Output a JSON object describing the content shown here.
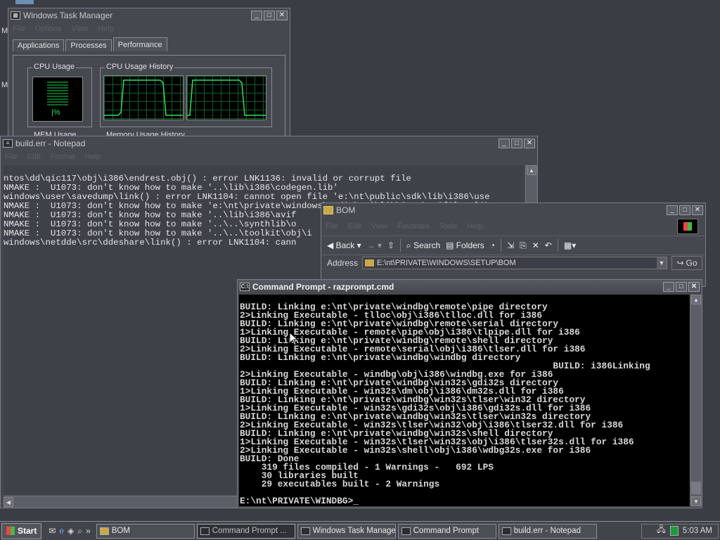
{
  "desktop": {
    "left_letter_1": "M",
    "left_letter_2": "M"
  },
  "taskmgr": {
    "title": "Windows Task Manager",
    "menu": [
      "File",
      "Options",
      "View",
      "Help"
    ],
    "tabs": [
      "Applications",
      "Processes",
      "Performance"
    ],
    "groups": {
      "cpu_usage": "CPU Usage",
      "cpu_history": "CPU Usage History",
      "mem_usage": "MEM Usage",
      "mem_history": "Memory Usage History"
    },
    "cpu_percent_label": "|%",
    "cpu_level": 0.0
  },
  "notepad": {
    "title": "build.err - Notepad",
    "menu": [
      "File",
      "Edit",
      "Format",
      "Help"
    ],
    "lines": [
      "ntos\\dd\\qic117\\obj\\i386\\endrest.obj() : error LNK1136: invalid or corrupt file",
      "NMAKE :  U1073: don't know how to make '..\\lib\\i386\\codegen.lib'",
      "windows\\user\\savedump\\link() : error LNK1104: cannot open file 'e:\\nt\\public\\sdk\\lib\\i386\\use",
      "NMAKE :  U1073: don't know how to make 'e:\\nt\\private\\windows\\media\\avi\\lib\\i386\\avifil32.lib",
      "NMAKE :  U1073: don't know how to make '..\\lib\\i386\\avif",
      "NMAKE :  U1073: don't know how to make '..\\..\\synthlib\\o",
      "NMAKE :  U1073: don't know how to make '..\\..\\toolkit\\obj\\i",
      "windows\\netdde\\src\\ddeshare\\link() : error LNK1104: cann"
    ]
  },
  "explorer": {
    "title": "BOM",
    "menu": [
      "File",
      "Edit",
      "View",
      "Favorites",
      "Tools",
      "Help"
    ],
    "toolbar": {
      "back": "Back",
      "search": "Search",
      "folders": "Folders"
    },
    "address_label": "Address",
    "address_value": "E:\\nt\\PRIVATE\\WINDOWS\\SETUP\\BOM",
    "go_label": "Go"
  },
  "cmd": {
    "title": "Command Prompt - razprompt.cmd",
    "lines": [
      "BUILD: Linking e:\\nt\\private\\windbg\\remote\\pipe directory",
      "2>Linking Executable - tlloc\\obj\\i386\\tlloc.dll for i386",
      "BUILD: Linking e:\\nt\\private\\windbg\\remote\\serial directory",
      "1>Linking Executable - remote\\pipe\\obj\\i386\\tlpipe.dll for i386",
      "BUILD: Linking e:\\nt\\private\\windbg\\remote\\shell directory",
      "2>Linking Executable - remote\\serial\\obj\\i386\\tlser.dll for i386",
      "BUILD: Linking e:\\nt\\private\\windbg\\windbg directory",
      "                                                          BUILD: i386Linking",
      "2>Linking Executable - windbg\\obj\\i386\\windbg.exe for i386",
      "BUILD: Linking e:\\nt\\private\\windbg\\win32s\\gdi32s directory",
      "1>Linking Executable - win32s\\dm\\obj\\i386\\dm32s.dll for i386",
      "BUILD: Linking e:\\nt\\private\\windbg\\win32s\\tlser\\win32 directory",
      "1>Linking Executable - win32s\\gdi32s\\obj\\i386\\gdi32s.dll for i386",
      "BUILD: Linking e:\\nt\\private\\windbg\\win32s\\tlser\\win32s directory",
      "2>Linking Executable - win32s\\tlser\\win32\\obj\\i386\\tlser32.dll for i386",
      "BUILD: Linking e:\\nt\\private\\windbg\\win32s\\shell directory",
      "1>Linking Executable - win32s\\tlser\\win32s\\obj\\i386\\tlser32s.dll for i386",
      "2>Linking Executable - win32s\\shell\\obj\\i386\\wdbg32s.exe for i386",
      "BUILD: Done",
      "",
      "    319 files compiled - 1 Warnings -   692 LPS",
      "    30 libraries built",
      "    29 executables built - 2 Warnings",
      "",
      "E:\\nt\\PRIVATE\\WINDBG>_"
    ]
  },
  "taskbar": {
    "start": "Start",
    "overflow": "»",
    "tasks": [
      "BOM",
      "Command Prompt ...",
      "Windows Task Manager",
      "Command Prompt",
      "build.err - Notepad"
    ],
    "clock": "5:03 AM"
  }
}
